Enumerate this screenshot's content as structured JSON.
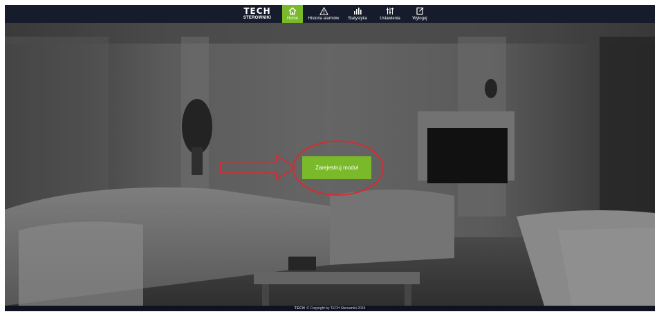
{
  "header": {
    "logo_brand": "TECH",
    "logo_sub": "STEROWNIKI",
    "nav": [
      {
        "label": "Home",
        "icon": "home-icon",
        "active": true
      },
      {
        "label": "Historia alarmów",
        "icon": "warning-icon",
        "active": false
      },
      {
        "label": "Statystyka",
        "icon": "bar-chart-icon",
        "active": false
      },
      {
        "label": "Ustawienia",
        "icon": "sliders-icon",
        "active": false
      },
      {
        "label": "Wyloguj",
        "icon": "logout-icon",
        "active": false
      }
    ]
  },
  "main": {
    "register_button": "Zarejestruj moduł"
  },
  "footer": {
    "brand": "TECH",
    "copyright": "© Copyright by TECH Sterowniki 2024"
  },
  "colors": {
    "accent": "#7ab929",
    "nav_bg": "#171c2c",
    "annotation": "#e2262b"
  }
}
